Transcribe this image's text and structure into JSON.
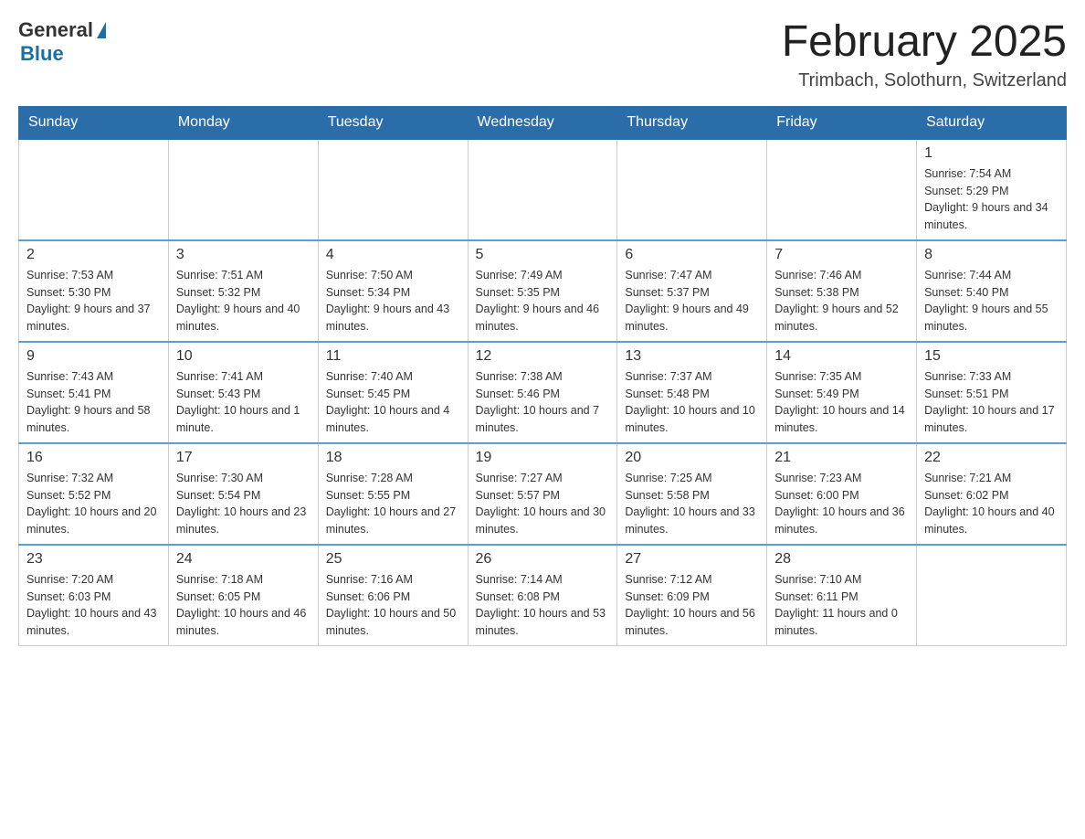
{
  "header": {
    "logo": {
      "general": "General",
      "blue": "Blue"
    },
    "title": "February 2025",
    "location": "Trimbach, Solothurn, Switzerland"
  },
  "calendar": {
    "days_of_week": [
      "Sunday",
      "Monday",
      "Tuesday",
      "Wednesday",
      "Thursday",
      "Friday",
      "Saturday"
    ],
    "weeks": [
      [
        {
          "day": "",
          "info": ""
        },
        {
          "day": "",
          "info": ""
        },
        {
          "day": "",
          "info": ""
        },
        {
          "day": "",
          "info": ""
        },
        {
          "day": "",
          "info": ""
        },
        {
          "day": "",
          "info": ""
        },
        {
          "day": "1",
          "info": "Sunrise: 7:54 AM\nSunset: 5:29 PM\nDaylight: 9 hours and 34 minutes."
        }
      ],
      [
        {
          "day": "2",
          "info": "Sunrise: 7:53 AM\nSunset: 5:30 PM\nDaylight: 9 hours and 37 minutes."
        },
        {
          "day": "3",
          "info": "Sunrise: 7:51 AM\nSunset: 5:32 PM\nDaylight: 9 hours and 40 minutes."
        },
        {
          "day": "4",
          "info": "Sunrise: 7:50 AM\nSunset: 5:34 PM\nDaylight: 9 hours and 43 minutes."
        },
        {
          "day": "5",
          "info": "Sunrise: 7:49 AM\nSunset: 5:35 PM\nDaylight: 9 hours and 46 minutes."
        },
        {
          "day": "6",
          "info": "Sunrise: 7:47 AM\nSunset: 5:37 PM\nDaylight: 9 hours and 49 minutes."
        },
        {
          "day": "7",
          "info": "Sunrise: 7:46 AM\nSunset: 5:38 PM\nDaylight: 9 hours and 52 minutes."
        },
        {
          "day": "8",
          "info": "Sunrise: 7:44 AM\nSunset: 5:40 PM\nDaylight: 9 hours and 55 minutes."
        }
      ],
      [
        {
          "day": "9",
          "info": "Sunrise: 7:43 AM\nSunset: 5:41 PM\nDaylight: 9 hours and 58 minutes."
        },
        {
          "day": "10",
          "info": "Sunrise: 7:41 AM\nSunset: 5:43 PM\nDaylight: 10 hours and 1 minute."
        },
        {
          "day": "11",
          "info": "Sunrise: 7:40 AM\nSunset: 5:45 PM\nDaylight: 10 hours and 4 minutes."
        },
        {
          "day": "12",
          "info": "Sunrise: 7:38 AM\nSunset: 5:46 PM\nDaylight: 10 hours and 7 minutes."
        },
        {
          "day": "13",
          "info": "Sunrise: 7:37 AM\nSunset: 5:48 PM\nDaylight: 10 hours and 10 minutes."
        },
        {
          "day": "14",
          "info": "Sunrise: 7:35 AM\nSunset: 5:49 PM\nDaylight: 10 hours and 14 minutes."
        },
        {
          "day": "15",
          "info": "Sunrise: 7:33 AM\nSunset: 5:51 PM\nDaylight: 10 hours and 17 minutes."
        }
      ],
      [
        {
          "day": "16",
          "info": "Sunrise: 7:32 AM\nSunset: 5:52 PM\nDaylight: 10 hours and 20 minutes."
        },
        {
          "day": "17",
          "info": "Sunrise: 7:30 AM\nSunset: 5:54 PM\nDaylight: 10 hours and 23 minutes."
        },
        {
          "day": "18",
          "info": "Sunrise: 7:28 AM\nSunset: 5:55 PM\nDaylight: 10 hours and 27 minutes."
        },
        {
          "day": "19",
          "info": "Sunrise: 7:27 AM\nSunset: 5:57 PM\nDaylight: 10 hours and 30 minutes."
        },
        {
          "day": "20",
          "info": "Sunrise: 7:25 AM\nSunset: 5:58 PM\nDaylight: 10 hours and 33 minutes."
        },
        {
          "day": "21",
          "info": "Sunrise: 7:23 AM\nSunset: 6:00 PM\nDaylight: 10 hours and 36 minutes."
        },
        {
          "day": "22",
          "info": "Sunrise: 7:21 AM\nSunset: 6:02 PM\nDaylight: 10 hours and 40 minutes."
        }
      ],
      [
        {
          "day": "23",
          "info": "Sunrise: 7:20 AM\nSunset: 6:03 PM\nDaylight: 10 hours and 43 minutes."
        },
        {
          "day": "24",
          "info": "Sunrise: 7:18 AM\nSunset: 6:05 PM\nDaylight: 10 hours and 46 minutes."
        },
        {
          "day": "25",
          "info": "Sunrise: 7:16 AM\nSunset: 6:06 PM\nDaylight: 10 hours and 50 minutes."
        },
        {
          "day": "26",
          "info": "Sunrise: 7:14 AM\nSunset: 6:08 PM\nDaylight: 10 hours and 53 minutes."
        },
        {
          "day": "27",
          "info": "Sunrise: 7:12 AM\nSunset: 6:09 PM\nDaylight: 10 hours and 56 minutes."
        },
        {
          "day": "28",
          "info": "Sunrise: 7:10 AM\nSunset: 6:11 PM\nDaylight: 11 hours and 0 minutes."
        },
        {
          "day": "",
          "info": ""
        }
      ]
    ]
  }
}
